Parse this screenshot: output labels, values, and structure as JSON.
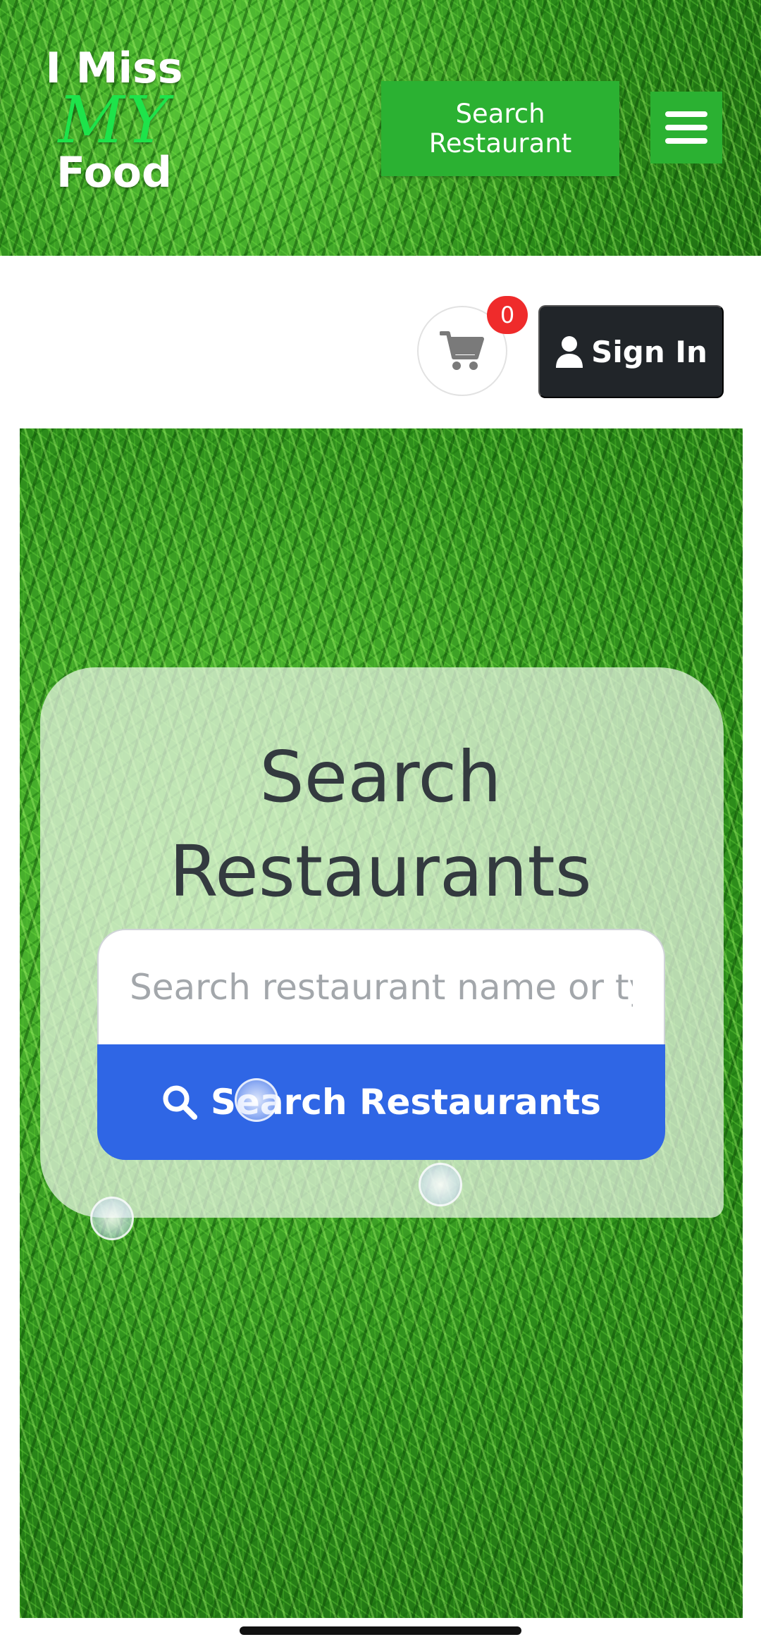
{
  "header": {
    "logo": {
      "line1": "I Miss",
      "line2": "MY",
      "line3": "Food"
    },
    "search_restaurant_label": "Search\nRestaurant",
    "menu_icon": "hamburger-menu-icon"
  },
  "actions": {
    "cart_icon": "shopping-cart-icon",
    "cart_count": "0",
    "signin_icon": "user-icon",
    "signin_label": "Sign In"
  },
  "search_card": {
    "title": "Search Restaurants",
    "input_placeholder": "Search restaurant name or type",
    "input_value": "",
    "submit_icon": "search-icon",
    "submit_label": "Search Restaurants"
  },
  "colors": {
    "header_button_green": "#2bb132",
    "logo_accent_green": "#1ee34a",
    "signin_dark": "#212529",
    "badge_red": "#ef2b2b",
    "primary_blue": "#2f66e5",
    "title_text": "#333a3f"
  }
}
